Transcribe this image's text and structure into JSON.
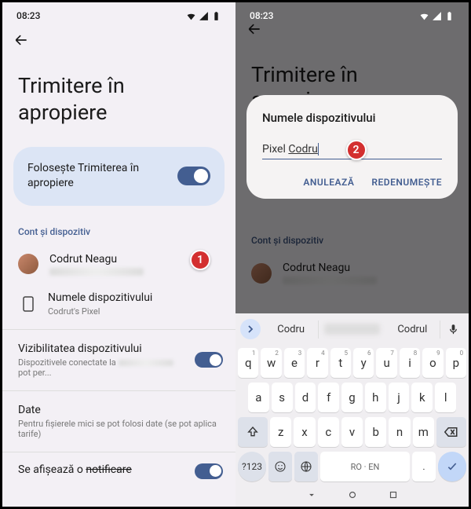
{
  "status": {
    "time": "08:23"
  },
  "left": {
    "title_line1": "Trimitere în",
    "title_line2": "apropiere",
    "toggle_label": "Folosește Trimiterea în apropiere",
    "section": "Cont și dispozitiv",
    "account_name": "Codrut Neagu",
    "device_name_label": "Numele dispozitivului",
    "device_name_value": "Codrut's Pixel",
    "visibility_title": "Vizibilitatea dispozitivului",
    "visibility_sub1": "Dispozitivele conectate la",
    "visibility_sub2": "pot per...",
    "data_title": "Date",
    "data_sub": "Pentru fișierele mici se pot folosi date (se pot aplica tarife)",
    "notif_text": "Se afișează o notificare",
    "badge": "1"
  },
  "right": {
    "section": "Cont și dispozitiv",
    "account_name": "Codrut Neagu",
    "dialog": {
      "title": "Numele dispozitivului",
      "value_prefix": "Pixel ",
      "value_editable": "Codru",
      "cancel": "ANULEAZĂ",
      "rename": "REDENUMEȘTE",
      "badge": "2"
    },
    "suggestions": {
      "w1": "Codru",
      "w3": "Codrul"
    },
    "keys": {
      "row1": [
        "q",
        "w",
        "e",
        "r",
        "t",
        "y",
        "u",
        "i",
        "o",
        "p"
      ],
      "row1s": [
        "1",
        "2",
        "3",
        "4",
        "5",
        "6",
        "7",
        "8",
        "9",
        "0"
      ],
      "row2": [
        "a",
        "s",
        "d",
        "f",
        "g",
        "h",
        "j",
        "k",
        "l"
      ],
      "row3": [
        "z",
        "x",
        "c",
        "v",
        "b",
        "n",
        "m"
      ]
    },
    "space_label": "RO · EN",
    "sym_label": "?123"
  }
}
